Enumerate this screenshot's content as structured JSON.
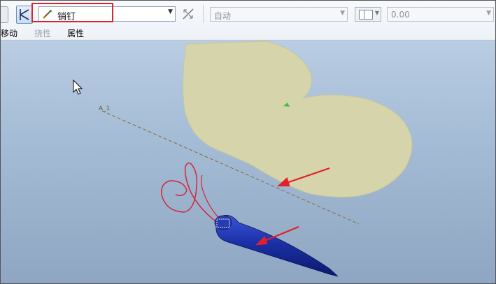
{
  "toolbar": {
    "constraint_type": "销钉",
    "auto_value": "自动",
    "offset_value": "0.00"
  },
  "tabs": [
    "移动",
    "挠性",
    "属性"
  ],
  "viewport": {
    "axis_label": "A_1"
  },
  "colors": {
    "highlight": "#d7262f",
    "part_surface": "#d6d4ab",
    "pin_body": "#1a2fa0",
    "arrow": "#e3202a"
  }
}
